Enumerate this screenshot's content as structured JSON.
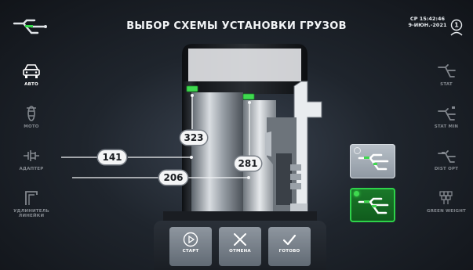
{
  "header": {
    "title": "ВЫБОР СХЕМЫ УСТАНОВКИ ГРУЗОВ",
    "time": "СР 15:42:46",
    "date": "9-ИЮН.-2021",
    "operator_number": "1"
  },
  "left_menu": [
    {
      "label": "АВТО",
      "icon": "car-icon",
      "active": true
    },
    {
      "label": "МОТО",
      "icon": "motorcycle-icon",
      "active": false
    },
    {
      "label": "АДАПТЕР",
      "icon": "adapter-icon",
      "active": false
    },
    {
      "label": "УДЛИНИТЕЛЬ ЛИНЕЙКИ",
      "icon": "gauge-extension-icon",
      "active": false
    }
  ],
  "right_menu": [
    {
      "label": "STAT",
      "icon": "stat-icon"
    },
    {
      "label": "STAT MIN",
      "icon": "stat-min-icon"
    },
    {
      "label": "DIST OPT",
      "icon": "dist-opt-icon"
    },
    {
      "label": "GREEN WEIGHT",
      "icon": "green-weight-icon"
    }
  ],
  "measurements": {
    "inner_plane": "323",
    "outer_plane": "281",
    "distance": "141",
    "diameter": "206"
  },
  "schemes": [
    {
      "name": "scheme-clip-on",
      "selected": false
    },
    {
      "name": "scheme-adhesive",
      "selected": true
    }
  ],
  "actions": [
    {
      "label": "СТАРТ",
      "icon": "play-icon"
    },
    {
      "label": "ОТМЕНА",
      "icon": "cancel-icon"
    },
    {
      "label": "ГОТОВО",
      "icon": "check-icon"
    }
  ],
  "colors": {
    "accent_green": "#2ed24a",
    "weight_green": "#3fd94f",
    "background": "#1f252d"
  }
}
